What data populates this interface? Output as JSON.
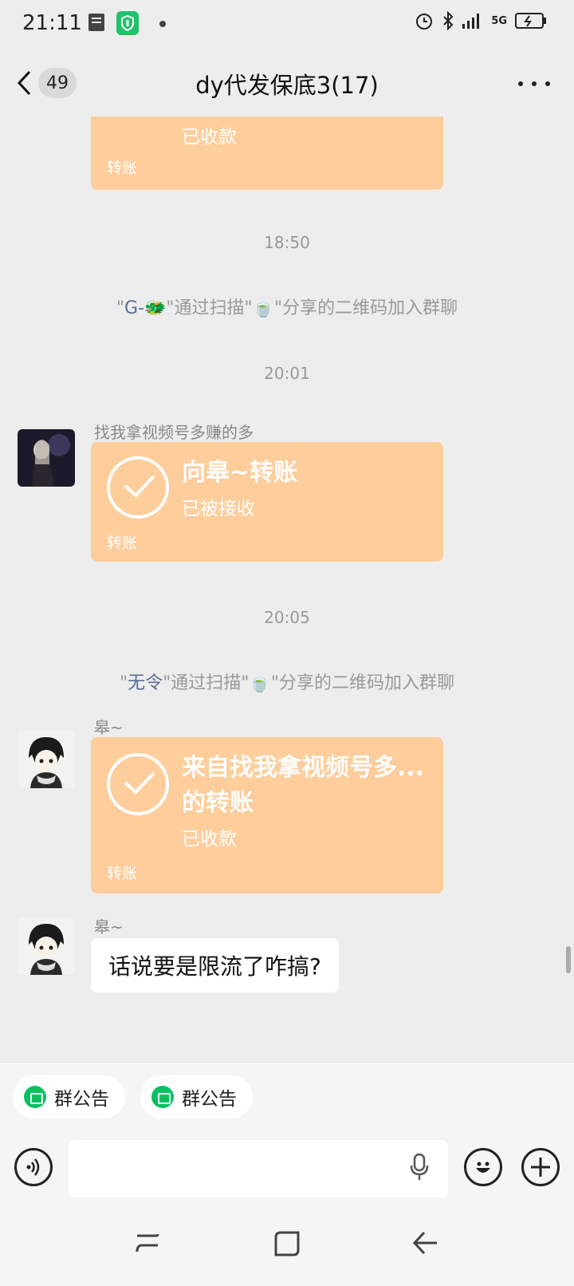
{
  "status_bar": {
    "time": "21:11",
    "network": "5G"
  },
  "header": {
    "unread_count": "49",
    "title": "dy代发保底3(17)"
  },
  "messages": {
    "m0_status": "已收款",
    "m0_label": "转账",
    "ts1": "18:50",
    "sys1": {
      "q1": "\"",
      "name": "G-🐲",
      "mid": "\"通过扫描\"🍵\"分享的二维码加入群聊"
    },
    "ts2": "20:01",
    "m1": {
      "sender": "找我拿视频号多赚的多",
      "title": "向皋~转账",
      "status": "已被接收",
      "label": "转账"
    },
    "ts3": "20:05",
    "sys2": {
      "q1": "\"",
      "name": "无令",
      "mid": "\"通过扫描\"🍵\"分享的二维码加入群聊"
    },
    "m2": {
      "sender": "皋~",
      "title_line1": "来自找我拿视频号多...",
      "title_line2": "的转账",
      "status": "已收款",
      "label": "转账"
    },
    "m3": {
      "sender": "皋~",
      "text": "话说要是限流了咋搞?"
    }
  },
  "quick_actions": [
    {
      "label": "群公告"
    },
    {
      "label": "群公告"
    }
  ],
  "input": {
    "placeholder": ""
  },
  "colors": {
    "background": "#ededed",
    "transfer_bubble": "#fdcd9b",
    "link_name": "#576b95",
    "accent_green": "#07c160"
  }
}
